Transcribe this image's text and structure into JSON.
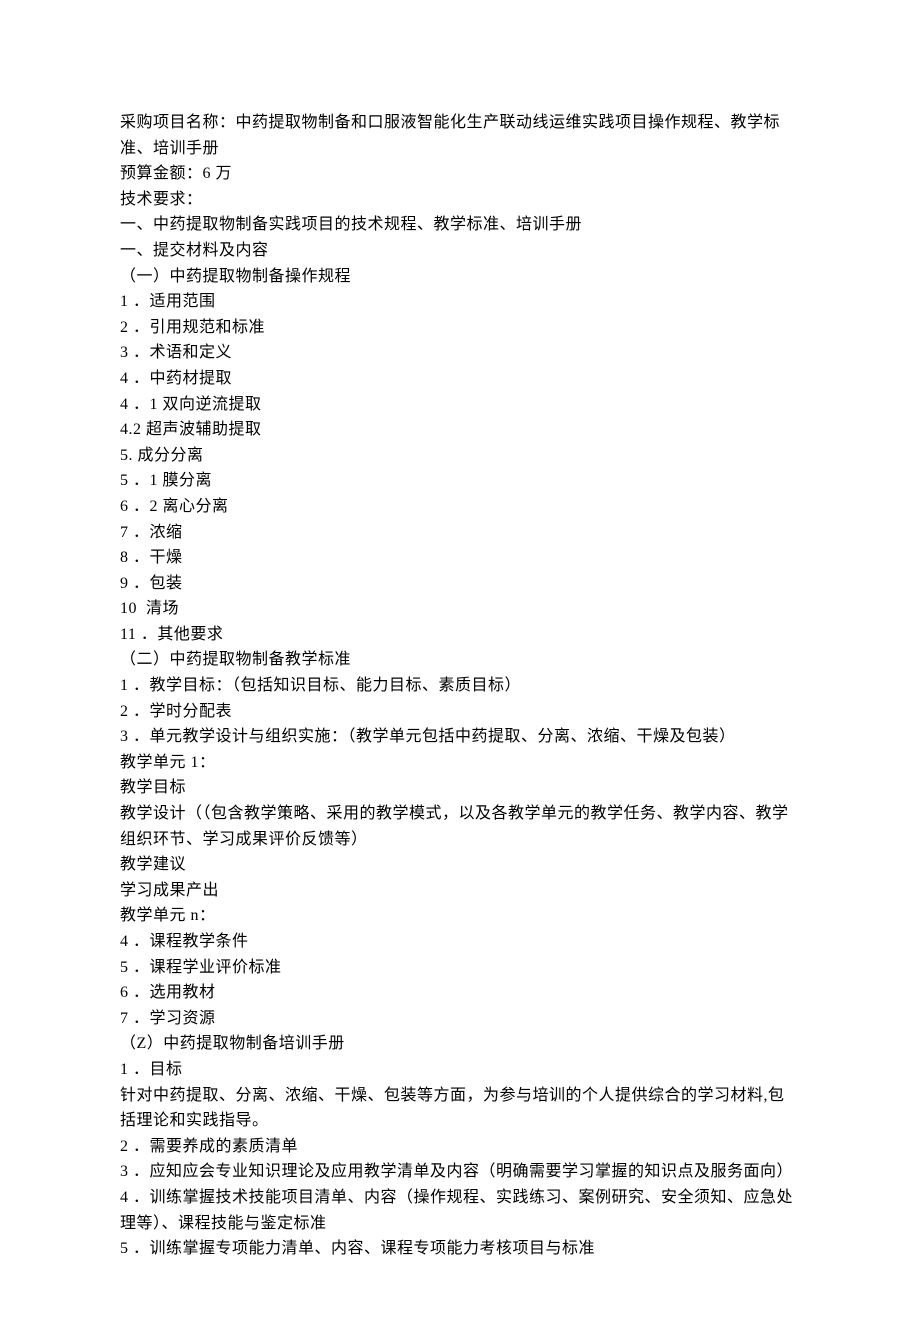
{
  "lines": [
    "采购项目名称：中药提取物制备和口服液智能化生产联动线运维实践项目操作规程、教学标准、培训手册",
    "预算金额：6 万",
    "技术要求：",
    "一、中药提取物制备实践项目的技术规程、教学标准、培训手册",
    "一、提交材料及内容",
    "（一）中药提取物制备操作规程",
    "1 ．适用范围",
    "2 ．引用规范和标准",
    "3 ．术语和定义",
    "4 ．中药材提取",
    "4 ．1 双向逆流提取",
    "4.2 超声波辅助提取",
    "5. 成分分离",
    "5 ．1 膜分离",
    "6 ．2 离心分离",
    "7 ．浓缩",
    "8 ．干燥",
    "9 ．包装",
    "10  清场",
    "11 ．其他要求",
    "（二）中药提取物制备教学标准",
    "1 ．教学目标：（包括知识目标、能力目标、素质目标）",
    "2 ．学时分配表",
    "3 ．单元教学设计与组织实施：（教学单元包括中药提取、分离、浓缩、干燥及包装）",
    "教学单元 1：",
    "教学目标",
    "教学设计（（包含教学策略、采用的教学模式，以及各教学单元的教学任务、教学内容、教学组织环节、学习成果评价反馈等）",
    "教学建议",
    "学习成果产出",
    "教学单元 n：",
    "4 ．课程教学条件",
    "5 ．课程学业评价标准",
    "6 ．选用教材",
    "7 ．学习资源",
    "（Z）中药提取物制备培训手册",
    "1 ．目标",
    "针对中药提取、分离、浓缩、干燥、包装等方面，为参与培训的个人提供综合的学习材料,包括理论和实践指导。",
    "2 ．需要养成的素质清单",
    "3 ．应知应会专业知识理论及应用教学清单及内容（明确需要学习掌握的知识点及服务面向）",
    "4 ．训练掌握技术技能项目清单、内容（操作规程、实践练习、案例研究、安全须知、应急处理等）、课程技能与鉴定标准",
    "5 ．训练掌握专项能力清单、内容、课程专项能力考核项目与标准"
  ]
}
